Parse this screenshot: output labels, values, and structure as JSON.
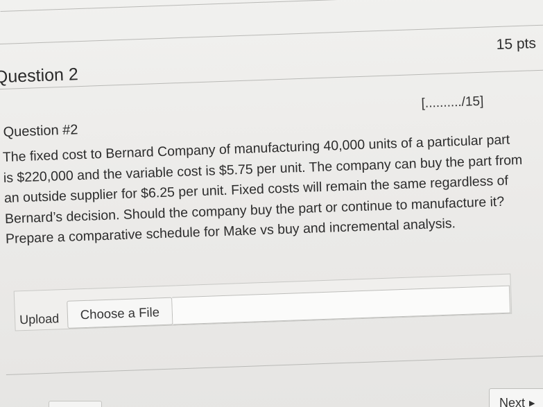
{
  "question_header": {
    "title": "Question 2",
    "points": "15 pts"
  },
  "question": {
    "score_blank": "[........../15]",
    "subtitle": "Question #2",
    "lines": [
      "The fixed cost to Bernard Company of manufacturing 40,000 units of a particular part",
      "is $220,000 and the variable cost is $5.75 per unit. The company can buy the part from",
      "an outside supplier for $6.25 per unit. Fixed costs will remain the same regardless of",
      "Bernard’s decision. Should the company buy the part or continue to manufacture it?",
      "Prepare a comparative schedule for Make vs buy and incremental analysis."
    ]
  },
  "upload": {
    "label": "Upload",
    "button_label": "Choose a File"
  },
  "footer": {
    "next_label": "Next",
    "next_icon": "triangle-right-icon"
  }
}
